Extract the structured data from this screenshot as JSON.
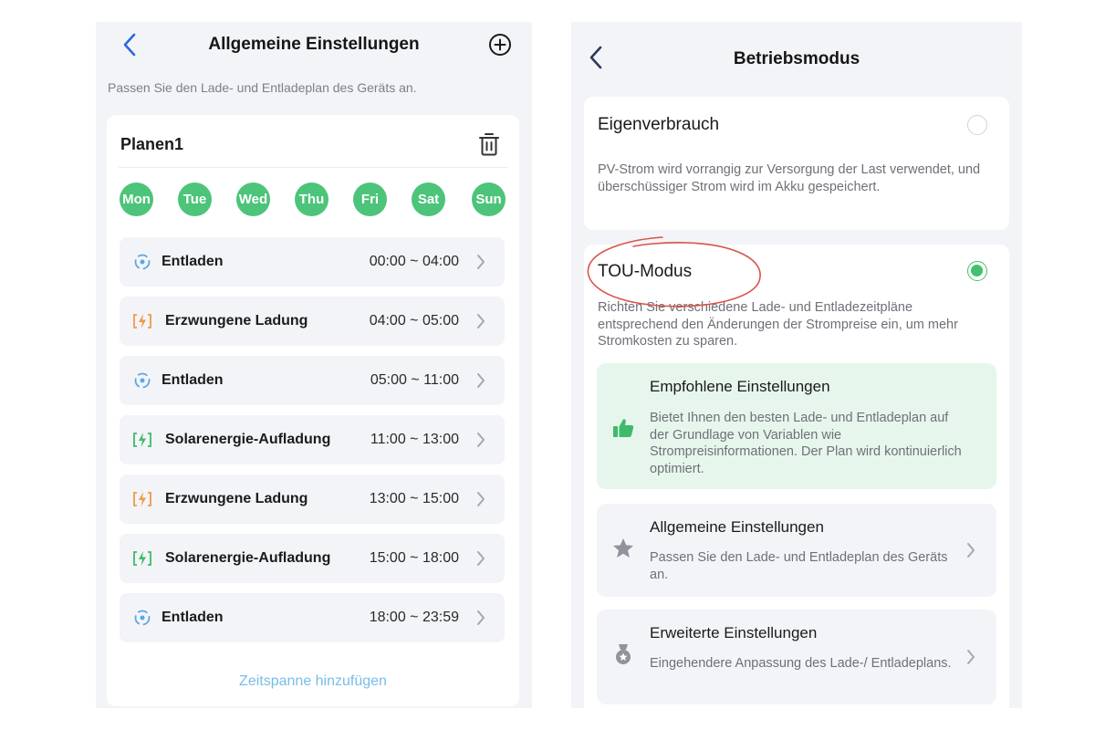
{
  "left": {
    "header": {
      "title": "Allgemeine Einstellungen"
    },
    "subtitle": "Passen Sie den Lade- und Entladeplan des Geräts an.",
    "plan": {
      "name": "Planen1",
      "days": [
        "Mon",
        "Tue",
        "Wed",
        "Thu",
        "Fri",
        "Sat",
        "Sun"
      ],
      "slots": [
        {
          "type": "discharge",
          "label": "Entladen",
          "time": "00:00 ~ 04:00"
        },
        {
          "type": "forced",
          "label": "Erzwungene Ladung",
          "time": "04:00 ~ 05:00"
        },
        {
          "type": "discharge",
          "label": "Entladen",
          "time": "05:00 ~ 11:00"
        },
        {
          "type": "solar",
          "label": "Solarenergie-Aufladung",
          "time": "11:00 ~ 13:00"
        },
        {
          "type": "forced",
          "label": "Erzwungene Ladung",
          "time": "13:00 ~ 15:00"
        },
        {
          "type": "solar",
          "label": "Solarenergie-Aufladung",
          "time": "15:00 ~ 18:00"
        },
        {
          "type": "discharge",
          "label": "Entladen",
          "time": "18:00 ~ 23:59"
        }
      ],
      "add_slot": "Zeitspanne hinzufügen"
    }
  },
  "right": {
    "header": {
      "title": "Betriebsmodus"
    },
    "modes": [
      {
        "name": "Eigenverbrauch",
        "selected": false,
        "description": "PV-Strom wird vorrangig zur Versorgung der Last verwendet, und überschüssiger Strom wird im Akku gespeichert."
      },
      {
        "name": "TOU-Modus",
        "selected": true,
        "description": "Richten Sie verschiedene Lade- und Entladezeitpläne entsprechend den Änderungen der Strompreise ein, um mehr Stromkosten zu sparen."
      }
    ],
    "options": [
      {
        "icon": "thumbs-up-icon",
        "title": "Empfohlene Einstellungen",
        "description": "Bietet Ihnen den besten Lade- und Entladeplan auf der Grundlage von Variablen wie Strompreisinformationen. Der Plan wird kontinuierlich optimiert."
      },
      {
        "icon": "star-icon",
        "title": "Allgemeine Einstellungen",
        "description": "Passen Sie den Lade- und Entladeplan des Geräts an."
      },
      {
        "icon": "badge-icon",
        "title": "Erweiterte Einstellungen",
        "description": "Eingehendere Anpassung des Lade-/ Entladeplans."
      }
    ]
  },
  "colors": {
    "accent_green": "#4cc47a",
    "link_blue": "#79bde9",
    "discharge_blue": "#5aa8e6",
    "forced_orange": "#ef9a48",
    "solar_green": "#3dbb6a",
    "annotation_red": "#d9534a"
  }
}
